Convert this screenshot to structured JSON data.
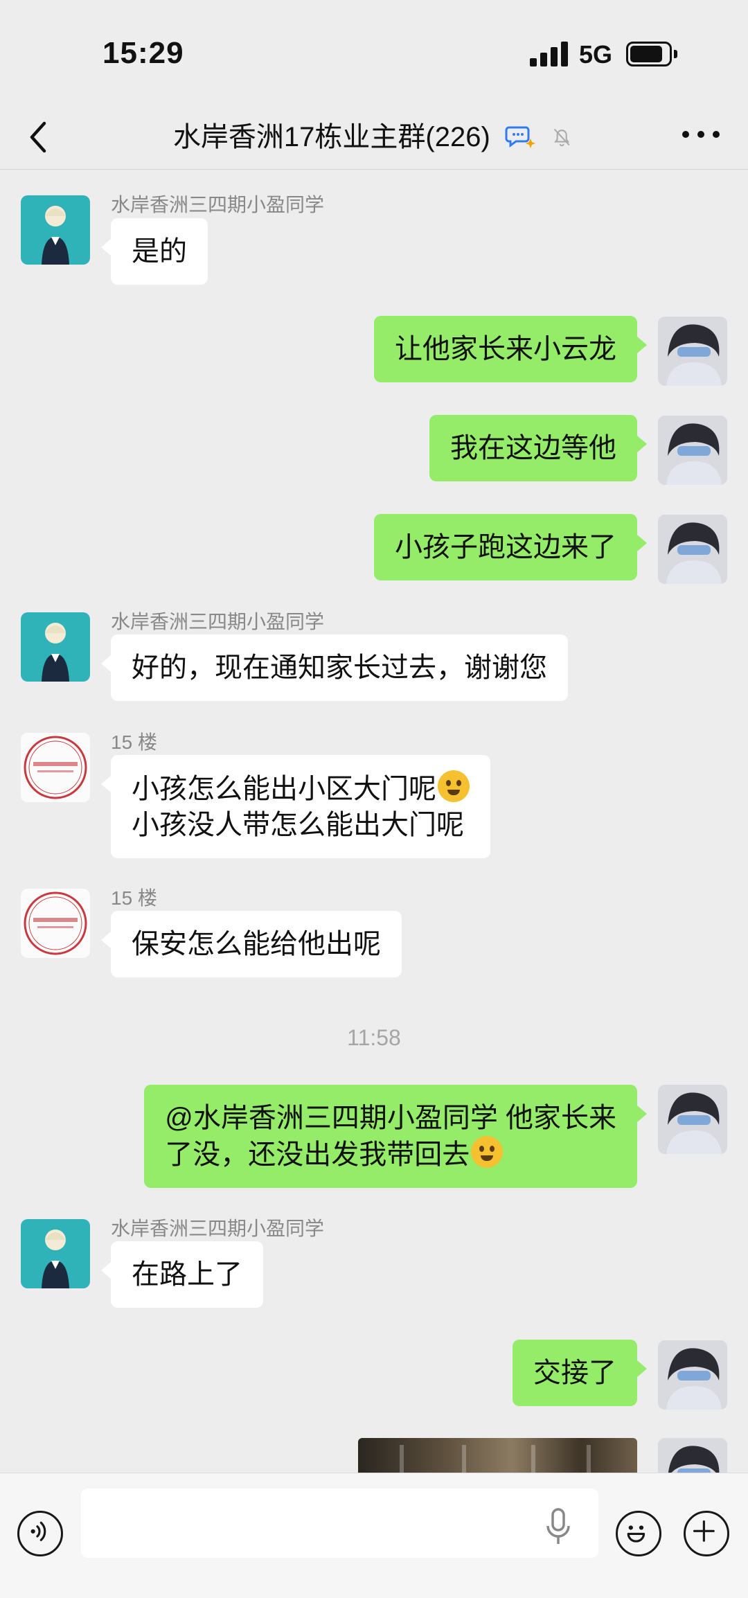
{
  "status_bar": {
    "time": "15:29",
    "network": "5G"
  },
  "nav": {
    "title": "水岸香洲17栋业主群(226)"
  },
  "messages": [
    {
      "sender": "水岸香洲三四期小盈同学",
      "text": "是的"
    },
    {
      "text": "让他家长来小云龙"
    },
    {
      "text": "我在这边等他"
    },
    {
      "text": "小孩子跑这边来了"
    },
    {
      "sender": "水岸香洲三四期小盈同学",
      "text": "好的，现在通知家长过去，谢谢您"
    },
    {
      "sender": "15 楼",
      "line1": "小孩怎么能出小区大门呢",
      "line2": "小孩没人带怎么能出大门呢"
    },
    {
      "sender": "15 楼",
      "text": "保安怎么能给他出呢"
    },
    {
      "line1": "@水岸香洲三四期小盈同学 他家长来",
      "line2": "了没，还没出发我带回去"
    },
    {
      "sender": "水岸香洲三四期小盈同学",
      "text": "在路上了"
    },
    {
      "text": "交接了"
    }
  ],
  "timestamp": "11:58",
  "colors": {
    "outgoing_bubble": "#95ec69",
    "incoming_bubble": "#ffffff",
    "background": "#ededed"
  },
  "icons": {
    "back": "chevron-left-icon",
    "ai": "chat-ai-icon",
    "mute": "bell-off-icon",
    "more": "more-dots-icon",
    "voice": "voice-icon",
    "mic": "mic-icon",
    "emoji": "smiley-icon",
    "add": "plus-icon"
  }
}
